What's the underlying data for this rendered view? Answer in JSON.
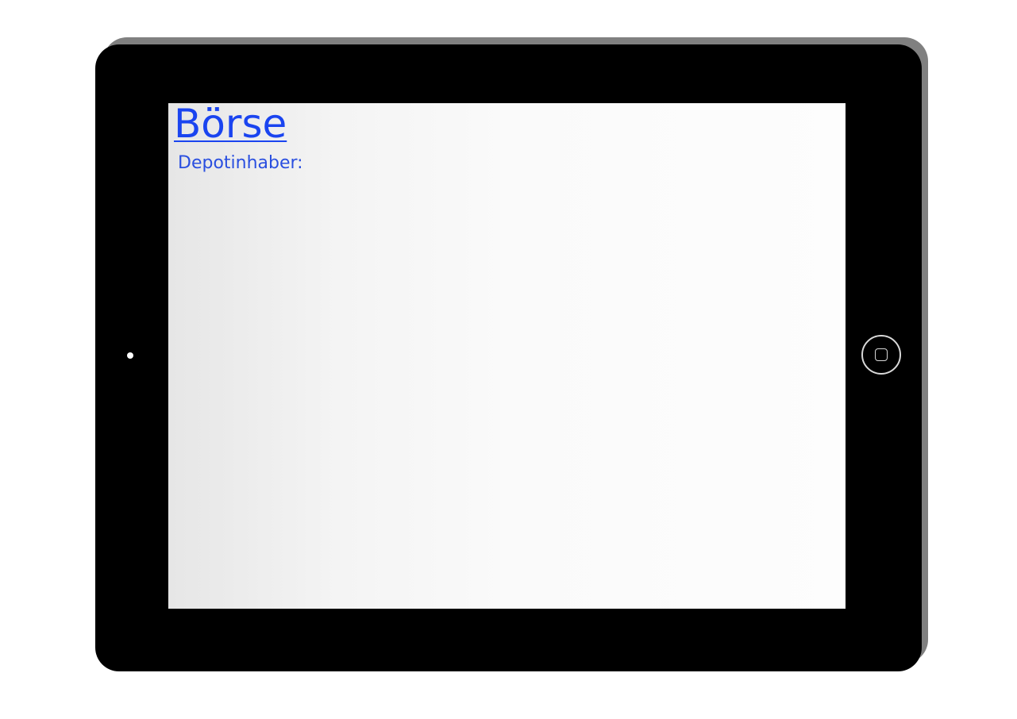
{
  "app": {
    "title": "Börse",
    "depot_holder_label": "Depotinhaber:"
  },
  "device": {
    "type": "tablet",
    "home_button_icon": "home-square-icon",
    "camera_icon": "camera-dot-icon"
  },
  "colors": {
    "title_link": "#1a44f0",
    "label_text": "#2a4fe0",
    "bezel": "#000000",
    "bezel_shadow": "#808080"
  }
}
